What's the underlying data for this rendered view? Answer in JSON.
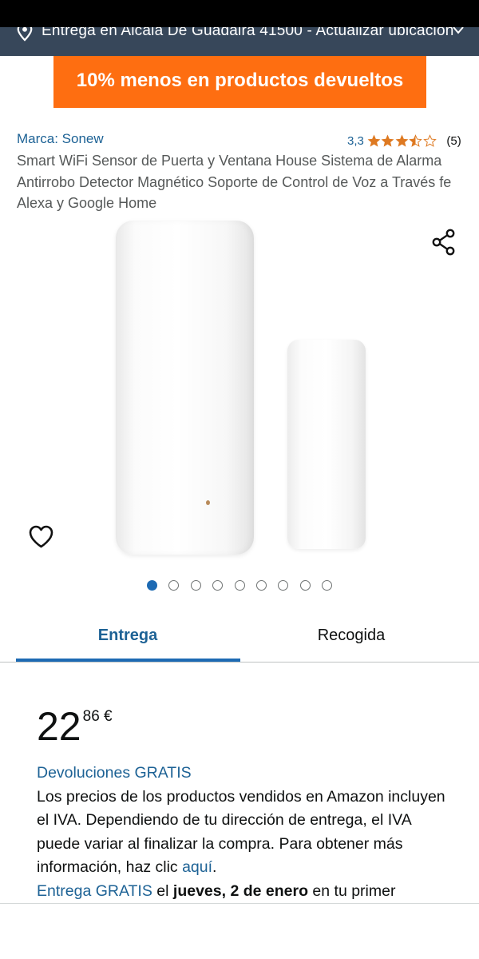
{
  "location": {
    "text": "Entrega en Alcalá De Guadaira 41500 - Actualizar ubicación",
    "icons": [
      "location-pin-icon",
      "chevron-down-icon"
    ]
  },
  "promo": {
    "text": "10% menos en productos devueltos",
    "color": "#fe6e11"
  },
  "product": {
    "brand": "Marca: Sonew",
    "rating_value": "3,3",
    "rating_stars": 3.5,
    "rating_count": "(5)",
    "title": "Smart WiFi Sensor de Puerta y Ventana House Sistema de Alarma Antirrobo Detector Magnético Soporte de Control de Voz a Través fe Alexa y Google Home"
  },
  "gallery": {
    "image_count": 9,
    "active_index": 0,
    "icons": [
      "share-icon",
      "heart-icon"
    ]
  },
  "tabs": {
    "entrega": "Entrega",
    "recogida": "Recogida",
    "active": "entrega"
  },
  "price": {
    "whole": "22",
    "fraction": "86 €"
  },
  "info": {
    "returns": "Devoluciones GRATIS",
    "vat_text": "Los precios de los productos vendidos en Amazon incluyen el IVA. Dependiendo de tu dirección de entrega, el IVA puede variar al finalizar la compra. Para obtener más información, haz clic",
    "vat_link": "aquí",
    "delivery_link": "Entrega GRATIS",
    "delivery_mid": "el",
    "delivery_date": "jueves, 2 de enero",
    "delivery_tail": "en tu primer"
  },
  "colors": {
    "link": "#1d6295",
    "accent": "#1d6ab3",
    "header_bg": "#37475a",
    "star": "#de7921"
  }
}
